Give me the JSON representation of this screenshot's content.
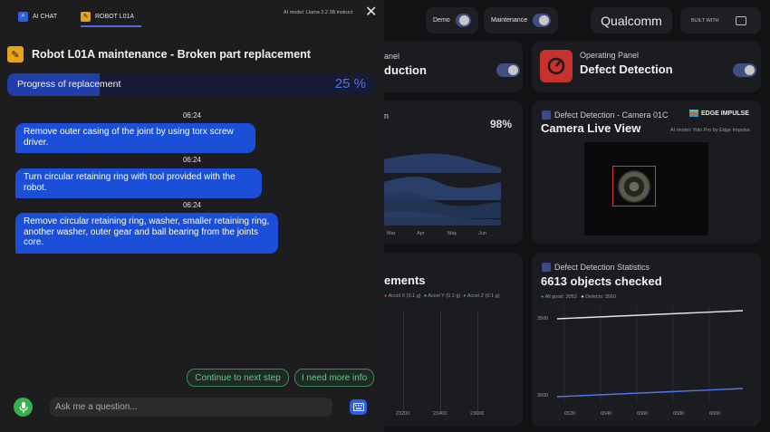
{
  "tabs": [
    {
      "label": "AI CHAT",
      "icon": "chat-icon"
    },
    {
      "label": "ROBOT L01A",
      "icon": "wrench-icon"
    }
  ],
  "model_label": "AI model: Llama 3.2 3B instruct",
  "title": "Robot L01A maintenance - Broken part replacement",
  "progress": {
    "label": "Progress of replacement",
    "percent_text": "25 %",
    "value": 0.25
  },
  "messages": [
    {
      "time": "06:24",
      "text": "Remove outer casing of the joint by using torx screw driver."
    },
    {
      "time": "06:24",
      "text": "Turn circular retaining ring with tool provided with the robot."
    },
    {
      "time": "06:24",
      "text": "Remove circular retaining ring, washer, smaller retaining ring, another washer, outer gear and ball bearing from the joints core."
    }
  ],
  "suggestions": [
    "Continue to next step",
    "I need more info"
  ],
  "input": {
    "placeholder": "Ask me a question..."
  },
  "topbar": {
    "demo_label": "Demo",
    "maintenance_label": "Maintenance",
    "brand": "Qualcomm",
    "built_with": "BUILT WITH"
  },
  "cards": {
    "panel_partial_title": "anel",
    "panel_partial_big": "duction",
    "operating_title": "Operating Panel",
    "operating_big": "Defect Detection",
    "chart_pct": "98%",
    "chart_partial_title": "n",
    "months": [
      "Mar",
      "Apr",
      "May",
      "Jun"
    ],
    "camera_title": "Defect Detection - Camera 01C",
    "camera_big": "Camera Live View",
    "edge_impulse": "EDGE IMPULSE",
    "camera_model": "AI model: Yolo Pro by Edge Impulse",
    "measurements_partial": "ements",
    "accel_legend": [
      "Accel X (0.1 g)",
      "Accel Y (0.1 g)",
      "Accel Z (0.1 g)"
    ],
    "accel_ticks": [
      "23200",
      "23400",
      "23600"
    ],
    "stats_title": "Defect Detection Statistics",
    "stats_big": "6613 objects checked",
    "stats_legend": [
      "All good: 3053",
      "Defects: 3560"
    ],
    "stats_y": [
      "3500",
      "3000"
    ],
    "stats_x": [
      "6520",
      "6540",
      "6560",
      "6580",
      "6600"
    ]
  },
  "colors": {
    "accent": "#1c4fd8",
    "progress": "#4f74ec",
    "suggestion": "#5ecb88",
    "mic": "#37b04d",
    "title_icon": "#e8a21c"
  }
}
